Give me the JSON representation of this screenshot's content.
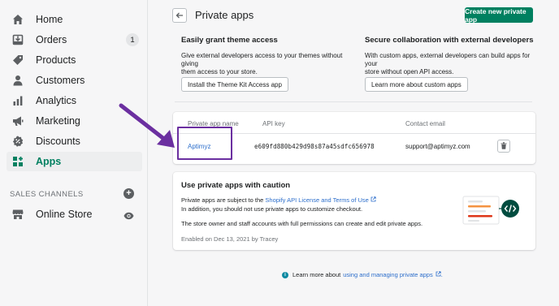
{
  "sidebar": {
    "items": [
      {
        "label": "Home",
        "icon": "home-icon"
      },
      {
        "label": "Orders",
        "icon": "orders-icon",
        "badge": "1"
      },
      {
        "label": "Products",
        "icon": "tag-icon"
      },
      {
        "label": "Customers",
        "icon": "person-icon"
      },
      {
        "label": "Analytics",
        "icon": "analytics-icon"
      },
      {
        "label": "Marketing",
        "icon": "megaphone-icon"
      },
      {
        "label": "Discounts",
        "icon": "discount-icon"
      },
      {
        "label": "Apps",
        "icon": "apps-icon",
        "active": true
      }
    ],
    "sales_channels_label": "SALES CHANNELS",
    "online_store_label": "Online Store"
  },
  "header": {
    "title": "Private apps",
    "create_button": "Create new private app"
  },
  "info_cards": [
    {
      "title": "Easily grant theme access",
      "line1": "Give external developers access to your themes without giving",
      "line2": "them access to your store.",
      "button": "Install the Theme Kit Access app"
    },
    {
      "title": "Secure collaboration with external developers",
      "line1": "With custom apps, external developers can build apps for your",
      "line2": "store without open API access.",
      "button": "Learn more about custom apps"
    }
  ],
  "table": {
    "headers": [
      "Private app name",
      "API key",
      "Contact email"
    ],
    "rows": [
      {
        "name": "Aptimyz",
        "api_key": "e609fd880b429d98s87a45sdfc656978",
        "email": "support@aptimyz.com"
      }
    ]
  },
  "caution": {
    "title": "Use private apps with caution",
    "line1_prefix": "Private apps are subject to the ",
    "line1_link": "Shopify API License and Terms of Use",
    "line2_prefix": "In addition, you should not use private apps to customize checkout.",
    "line3": "The store owner and staff accounts with full permissions can create and edit private apps.",
    "enabled": "Enabled on Dec 13, 2021 by Tracey"
  },
  "footer": {
    "prefix": "Learn more about",
    "link": "using and managing private apps"
  },
  "colors": {
    "accent": "#008060",
    "link": "#2c6ecb",
    "annotation": "#6b2fa0"
  }
}
